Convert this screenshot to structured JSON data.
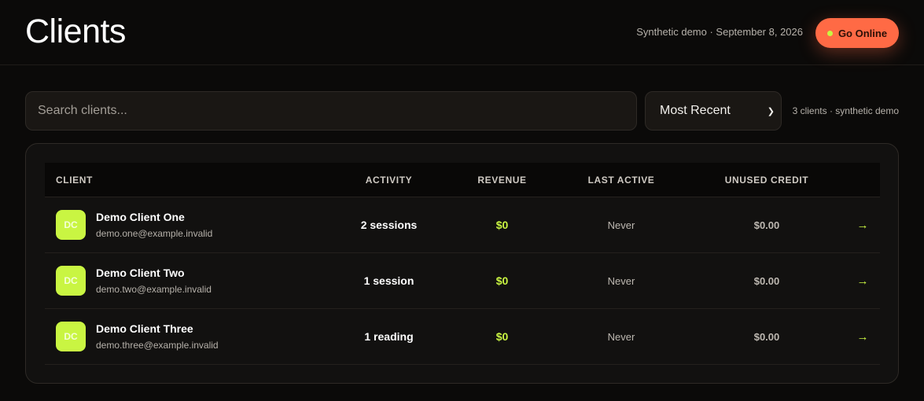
{
  "header": {
    "title": "Clients",
    "meta": "Synthetic demo · September 8, 2026",
    "go_online_label": "Go Online"
  },
  "toolbar": {
    "search_placeholder": "Search clients...",
    "sort_selected": "Most Recent",
    "count_text": "3 clients · synthetic demo"
  },
  "table": {
    "columns": {
      "client": "CLIENT",
      "activity": "ACTIVITY",
      "revenue": "REVENUE",
      "last_active": "LAST ACTIVE",
      "unused_credit": "UNUSED CREDIT"
    },
    "rows": [
      {
        "initials": "DC",
        "name": "Demo Client One",
        "email": "demo.one@example.invalid",
        "activity": "2 sessions",
        "revenue": "$0",
        "last_active": "Never",
        "credit": "$0.00"
      },
      {
        "initials": "DC",
        "name": "Demo Client Two",
        "email": "demo.two@example.invalid",
        "activity": "1 session",
        "revenue": "$0",
        "last_active": "Never",
        "credit": "$0.00"
      },
      {
        "initials": "DC",
        "name": "Demo Client Three",
        "email": "demo.three@example.invalid",
        "activity": "1 reading",
        "revenue": "$0",
        "last_active": "Never",
        "credit": "$0.00"
      }
    ]
  },
  "colors": {
    "accent_lime": "#c9f542",
    "accent_orange": "#ff6a45",
    "background": "#0b0a09"
  },
  "icons": {
    "row_action": "arrow-right-icon",
    "status": "status-dot-icon",
    "select": "chevron-down-icon"
  }
}
